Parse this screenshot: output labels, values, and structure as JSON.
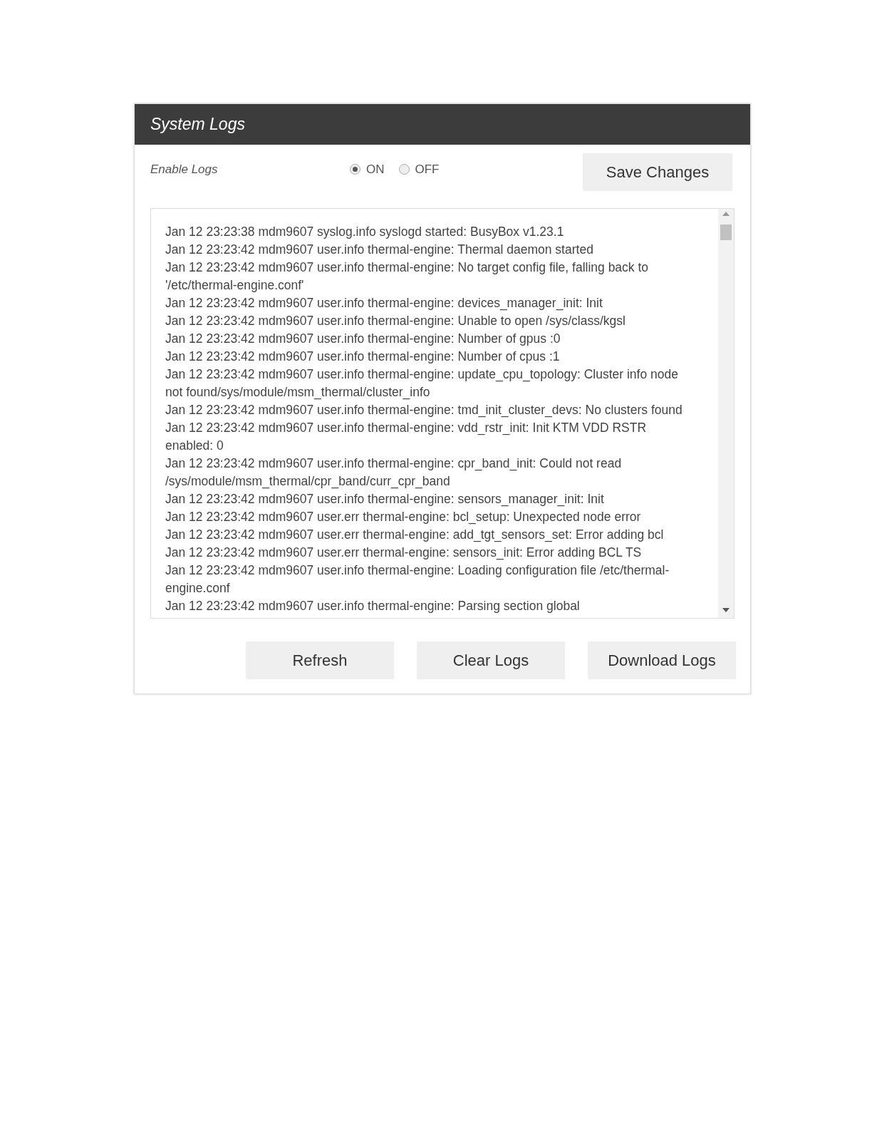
{
  "panel": {
    "title": "System Logs"
  },
  "enable_logs": {
    "label": "Enable Logs",
    "options": [
      {
        "label": "ON",
        "selected": true
      },
      {
        "label": "OFF",
        "selected": false
      }
    ]
  },
  "save_button": "Save Changes",
  "log_lines": [
    "Jan 12 23:23:38 mdm9607 syslog.info syslogd started: BusyBox v1.23.1",
    "Jan 12 23:23:42 mdm9607 user.info thermal-engine: Thermal daemon started",
    "Jan 12 23:23:42 mdm9607 user.info thermal-engine: No target config file, falling back to '/etc/thermal-engine.conf'",
    "Jan 12 23:23:42 mdm9607 user.info thermal-engine: devices_manager_init: Init",
    "Jan 12 23:23:42 mdm9607 user.info thermal-engine: Unable to open /sys/class/kgsl",
    "Jan 12 23:23:42 mdm9607 user.info thermal-engine: Number of gpus :0",
    "Jan 12 23:23:42 mdm9607 user.info thermal-engine: Number of cpus :1",
    "Jan 12 23:23:42 mdm9607 user.info thermal-engine: update_cpu_topology: Cluster info node not found/sys/module/msm_thermal/cluster_info",
    "Jan 12 23:23:42 mdm9607 user.info thermal-engine: tmd_init_cluster_devs: No clusters found",
    "Jan 12 23:23:42 mdm9607 user.info thermal-engine: vdd_rstr_init: Init KTM VDD RSTR enabled: 0",
    "Jan 12 23:23:42 mdm9607 user.info thermal-engine: cpr_band_init: Could not read /sys/module/msm_thermal/cpr_band/curr_cpr_band",
    "Jan 12 23:23:42 mdm9607 user.info thermal-engine: sensors_manager_init: Init",
    "Jan 12 23:23:42 mdm9607 user.err thermal-engine: bcl_setup: Unexpected node error",
    "Jan 12 23:23:42 mdm9607 user.err thermal-engine: add_tgt_sensors_set: Error adding bcl",
    "Jan 12 23:23:42 mdm9607 user.err thermal-engine: sensors_init: Error adding BCL TS",
    "Jan 12 23:23:42 mdm9607 user.info thermal-engine: Loading configuration file /etc/thermal-engine.conf",
    "Jan 12 23:23:42 mdm9607 user.info thermal-engine: Parsing section global"
  ],
  "action_buttons": [
    "Refresh",
    "Clear Logs",
    "Download Logs"
  ]
}
